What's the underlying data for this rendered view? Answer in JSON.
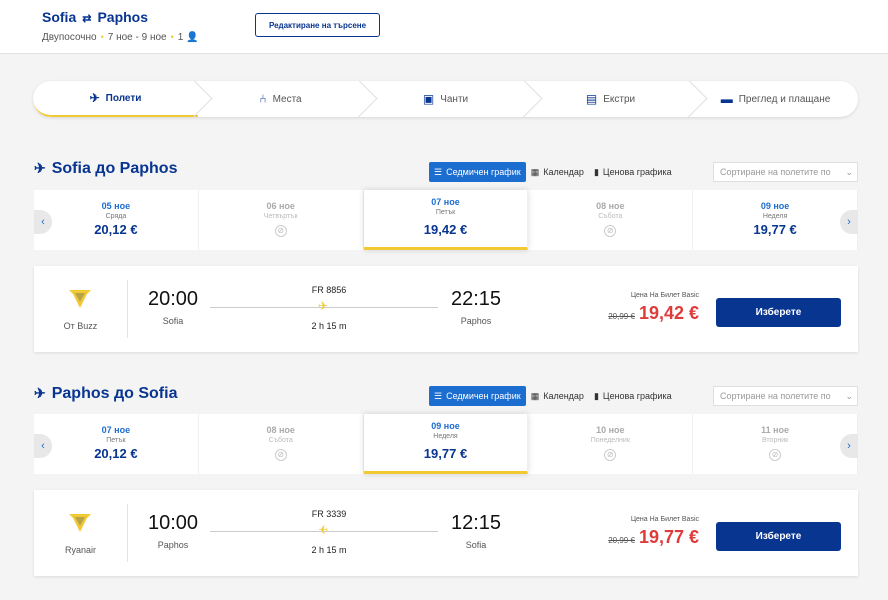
{
  "header": {
    "origin": "Sofia",
    "destination": "Paphos",
    "trip_type": "Двупосочно",
    "dates": "7 ное - 9 ное",
    "passengers": "1",
    "edit_label": "Редактиране на търсене"
  },
  "steps": [
    {
      "label": "Полети",
      "icon": "plane-icon"
    },
    {
      "label": "Места",
      "icon": "seat-icon"
    },
    {
      "label": "Чанти",
      "icon": "bag-icon"
    },
    {
      "label": "Екстри",
      "icon": "bus-icon"
    },
    {
      "label": "Преглед и плащане",
      "icon": "card-icon"
    }
  ],
  "view_tabs": {
    "weekly": "Седмичен график",
    "calendar": "Календар",
    "price_chart": "Ценова графика",
    "sort_placeholder": "Сортиране на полетите по"
  },
  "outbound": {
    "title": "Sofia до Paphos",
    "dates": [
      {
        "date": "05 ное",
        "weekday": "Сряда",
        "price": "20,12 €"
      },
      {
        "date": "06 ное",
        "weekday": "Четвъртък",
        "price": ""
      },
      {
        "date": "07 ное",
        "weekday": "Петък",
        "price": "19,42 €"
      },
      {
        "date": "08 ное",
        "weekday": "Събота",
        "price": ""
      },
      {
        "date": "09 ное",
        "weekday": "Неделя",
        "price": "19,77 €"
      }
    ],
    "flight": {
      "operator": "От Buzz",
      "dep_time": "20:00",
      "dep_city": "Sofia",
      "flight_no": "FR 8856",
      "duration": "2 h 15 m",
      "arr_time": "22:15",
      "arr_city": "Paphos",
      "fare_label": "Цена На Билет Basic",
      "old_price": "20,99 €",
      "price": "19,42 €",
      "select_label": "Изберете"
    }
  },
  "inbound": {
    "title": "Paphos до Sofia",
    "dates": [
      {
        "date": "07 ное",
        "weekday": "Петък",
        "price": "20,12 €"
      },
      {
        "date": "08 ное",
        "weekday": "Събота",
        "price": ""
      },
      {
        "date": "09 ное",
        "weekday": "Неделя",
        "price": "19,77 €"
      },
      {
        "date": "10 ное",
        "weekday": "Понеделник",
        "price": ""
      },
      {
        "date": "11 ное",
        "weekday": "Вторник",
        "price": ""
      }
    ],
    "flight": {
      "operator": "Ryanair",
      "dep_time": "10:00",
      "dep_city": "Paphos",
      "flight_no": "FR 3339",
      "duration": "2 h 15 m",
      "arr_time": "12:15",
      "arr_city": "Sofia",
      "fare_label": "Цена На Билет Basic",
      "old_price": "20,99 €",
      "price": "19,77 €",
      "select_label": "Изберете"
    }
  },
  "colors": {
    "brand": "#073590",
    "accent": "#f1c933",
    "link": "#1c6dd0",
    "sale": "#e03b3b"
  }
}
